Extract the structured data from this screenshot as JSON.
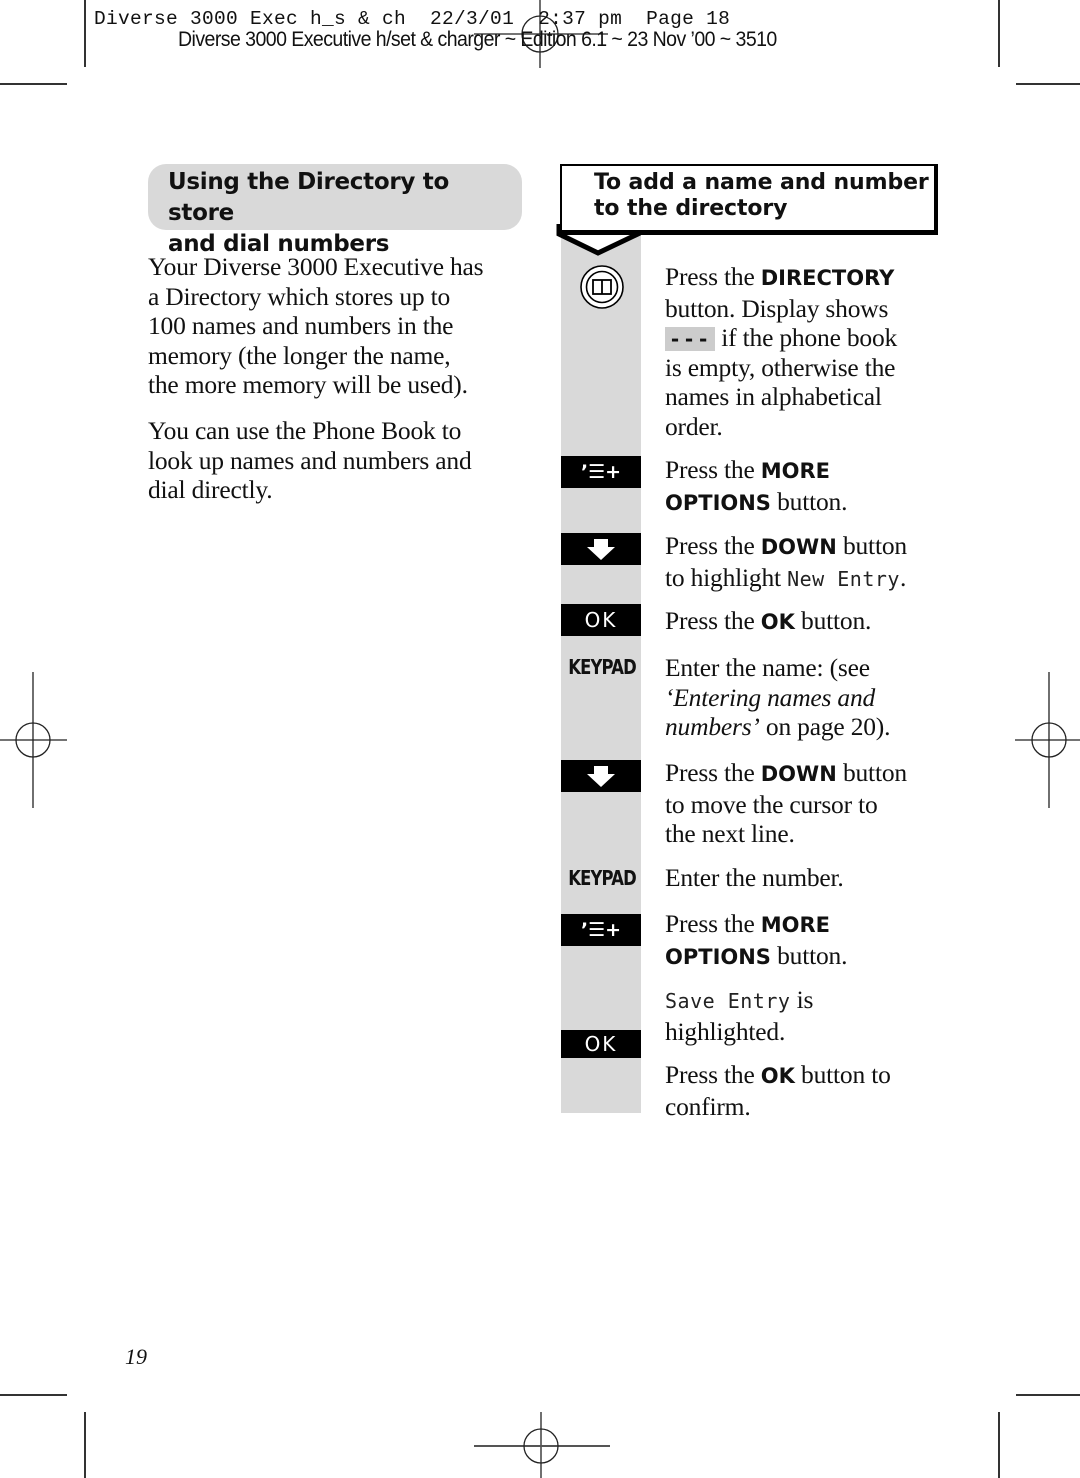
{
  "slug": {
    "line1": "Diverse 3000 Exec h_s & ch  22/3/01  2:37 pm  Page 18",
    "line2": "Diverse 3000 Executive h/set & charger ~ Edition 6.1 ~ 23 Nov ’00 ~ 3510"
  },
  "left_column": {
    "section_title": [
      "Using the Directory to store",
      "and dial numbers"
    ],
    "paragraphs": [
      [
        "Your Diverse 3000 Executive has",
        "a Directory which stores up to",
        "100 names and numbers in the",
        "memory (the longer the name,",
        "the more memory will be used)."
      ],
      [
        "You can use the Phone Book to",
        "look up names and numbers and",
        "dial directly."
      ]
    ]
  },
  "right_column": {
    "box_title": [
      "To add a name and number",
      "to the directory"
    ],
    "keys": {
      "directory": "directory-icon",
      "more_options": "’☰+",
      "down": "down-arrow-icon",
      "ok": "OK",
      "keypad": "KEYPAD"
    },
    "steps": [
      {
        "key": "directory",
        "pre": "Press the ",
        "bold": "DIRECTORY",
        "post": " button. Display shows",
        "lcd": "---",
        "post2": " if the phone book is empty, otherwise the names in alphabetical order."
      },
      {
        "key": "more_options",
        "pre": "Press the ",
        "bold1": "MORE",
        "bold2": "OPTIONS",
        "post": " button."
      },
      {
        "key": "down",
        "pre": "Press the ",
        "bold": "DOWN",
        "post": " button",
        "line2_pre": "to highlight ",
        "lcd": "New Entry",
        "line2_post": "."
      },
      {
        "key": "ok",
        "pre": "Press the ",
        "bold": "OK",
        "post": " button."
      },
      {
        "key": "keypad",
        "line1": "Enter the name: (see",
        "italic1": "‘Entering names and",
        "italic2": "numbers’",
        "line3_post": " on page 20)."
      },
      {
        "key": "down",
        "pre": "Press the ",
        "bold": "DOWN",
        "post": " button",
        "line2": "to move the cursor to",
        "line3": "the next line."
      },
      {
        "key": "keypad",
        "text": "Enter the number."
      },
      {
        "key": "more_options",
        "pre": "Press the ",
        "bold1": "MORE",
        "bold2": "OPTIONS",
        "post": " button."
      },
      {
        "lcd": "Save Entry",
        "post": " is",
        "line2": "highlighted."
      },
      {
        "key": "ok",
        "pre": "Press the ",
        "bold": "OK",
        "post": " button to",
        "line2": "confirm."
      }
    ]
  },
  "footer": {
    "page_number": "19"
  }
}
